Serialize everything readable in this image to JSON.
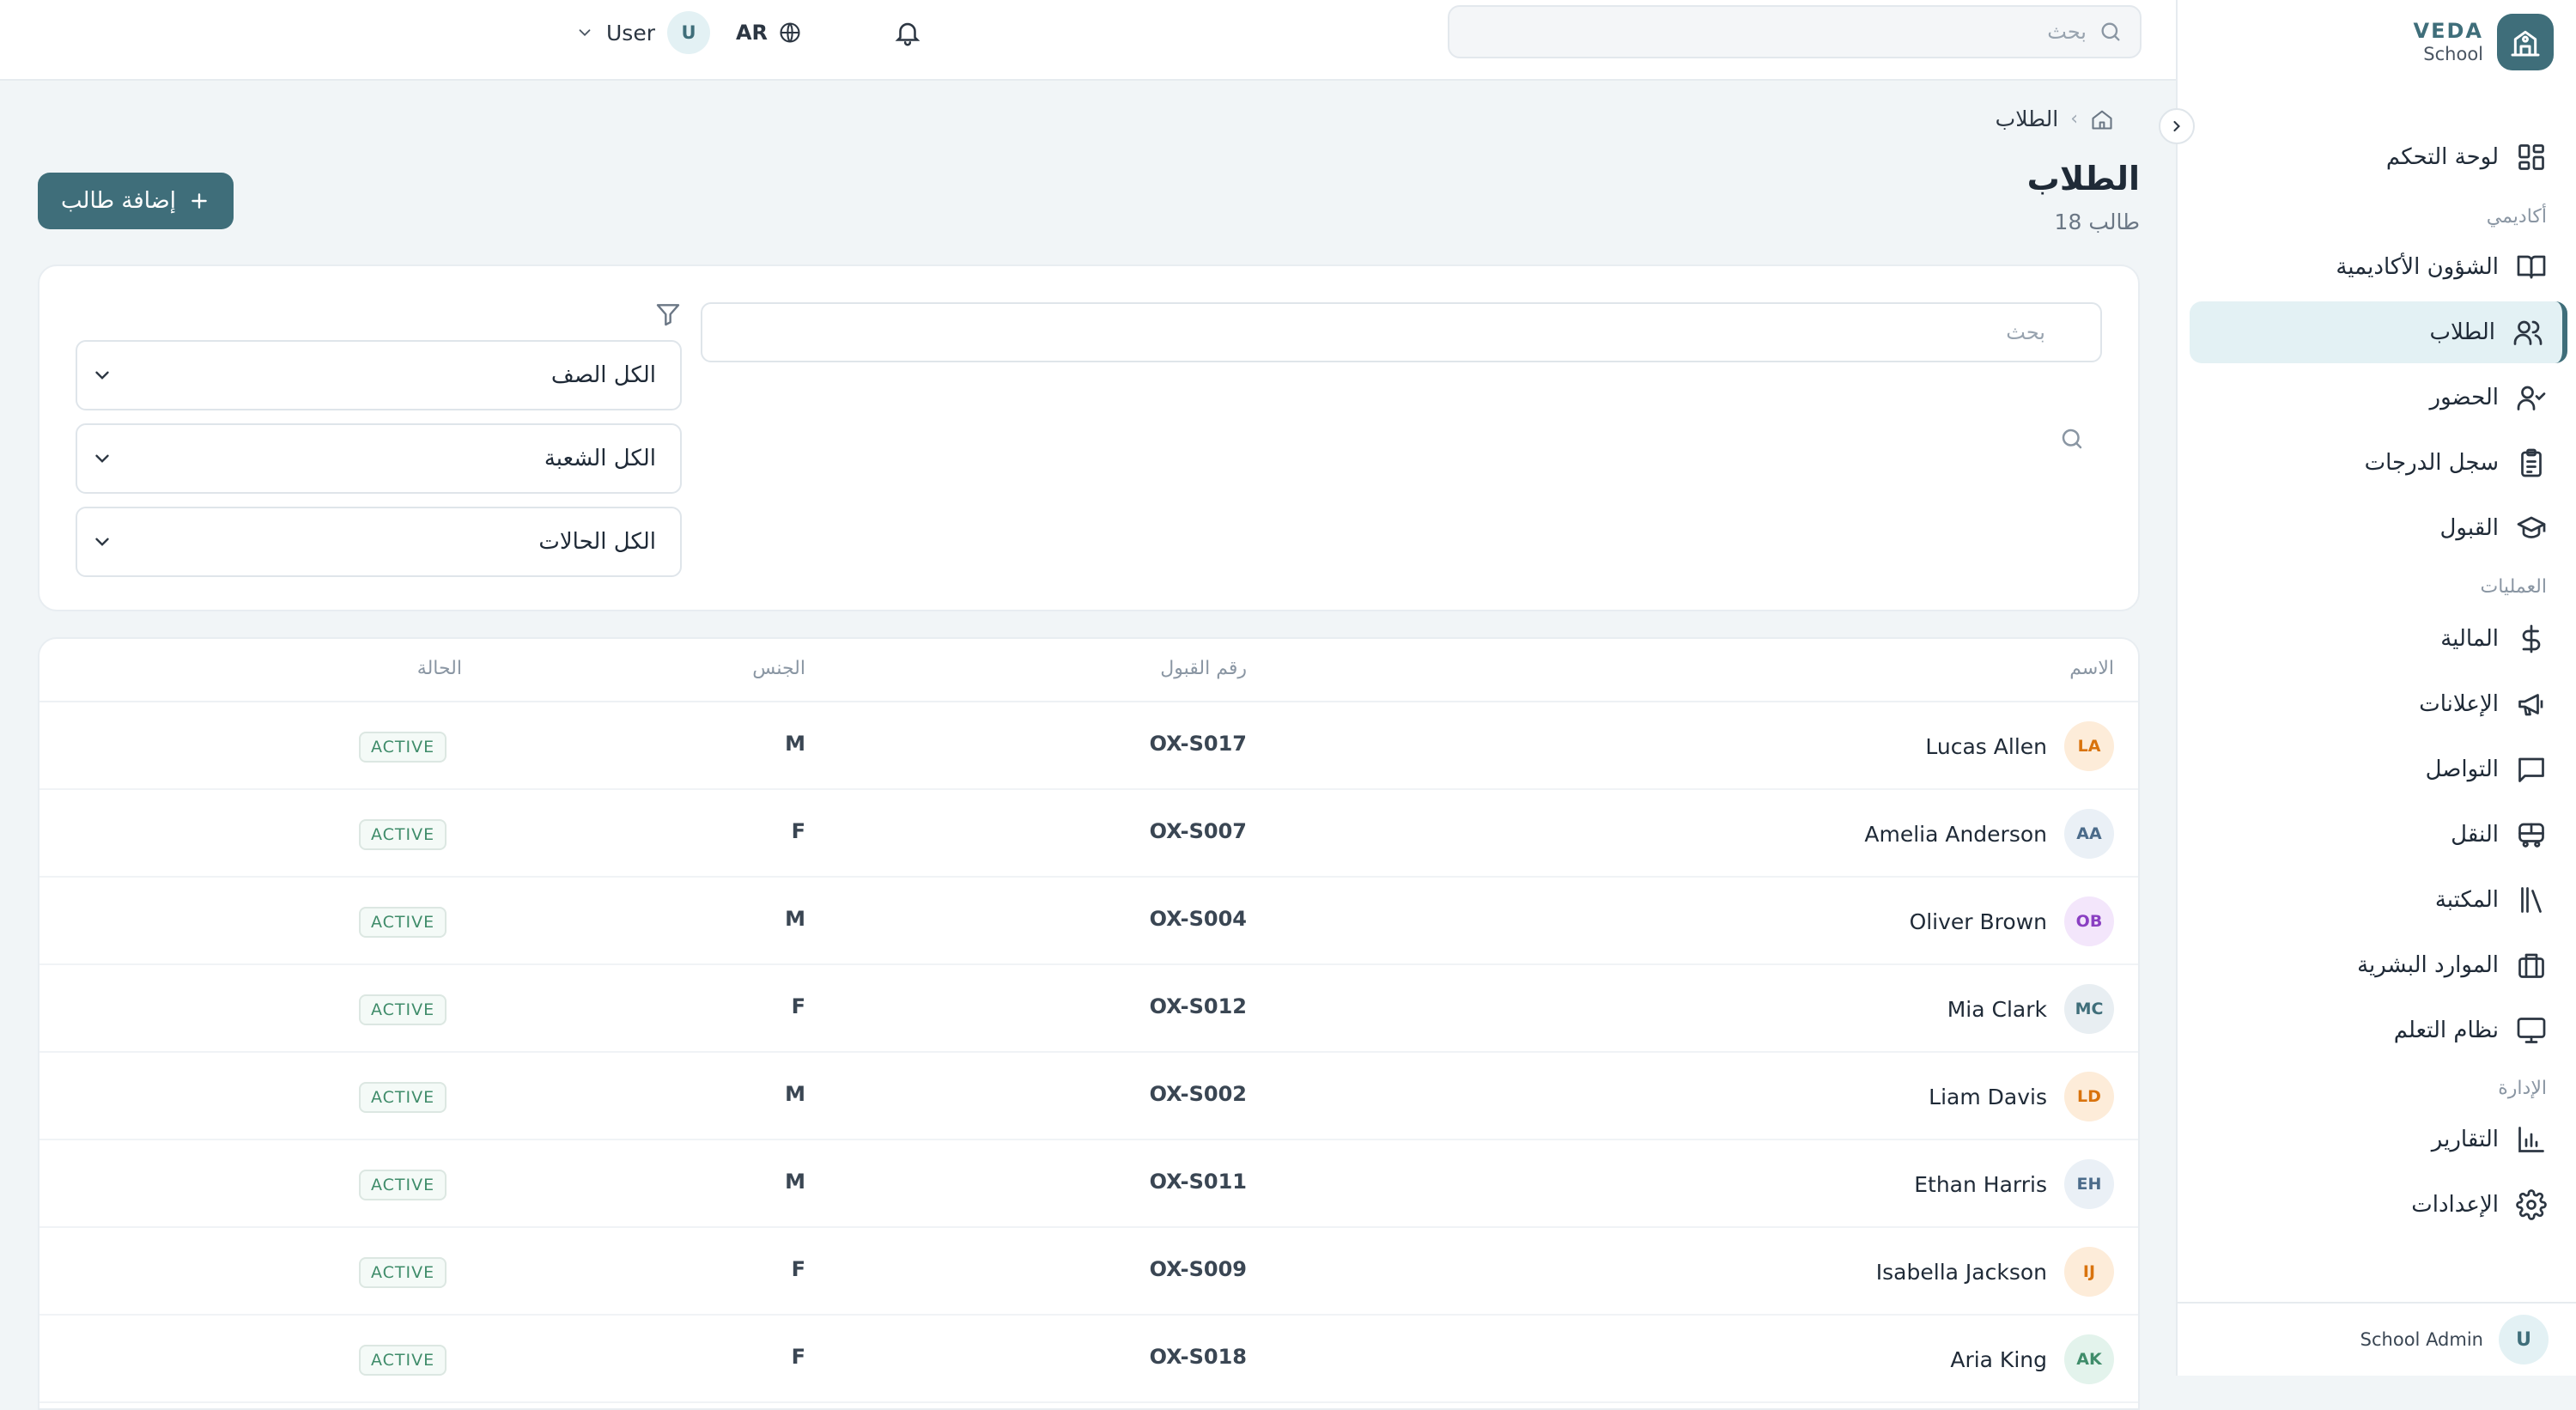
{
  "brand": {
    "name": "VEDA",
    "subtitle": "School"
  },
  "topbar": {
    "search_placeholder": "بحث",
    "language": "AR",
    "user_name": "User",
    "user_initial": "U"
  },
  "sidebar": {
    "sections": {
      "academic": "أكاديمي",
      "operations": "العمليات",
      "admin": "الإدارة"
    },
    "items": [
      {
        "label": "لوحة التحكم",
        "icon": "dashboard-icon"
      },
      {
        "label": "الشؤون الأكاديمية",
        "icon": "book-icon"
      },
      {
        "label": "الطلاب",
        "icon": "users-icon"
      },
      {
        "label": "الحضور",
        "icon": "user-check-icon"
      },
      {
        "label": "سجل الدرجات",
        "icon": "clipboard-icon"
      },
      {
        "label": "القبول",
        "icon": "graduation-cap-icon"
      },
      {
        "label": "المالية",
        "icon": "dollar-icon"
      },
      {
        "label": "الإعلانات",
        "icon": "megaphone-icon"
      },
      {
        "label": "التواصل",
        "icon": "message-icon"
      },
      {
        "label": "النقل",
        "icon": "bus-icon"
      },
      {
        "label": "المكتبة",
        "icon": "library-icon"
      },
      {
        "label": "الموارد البشرية",
        "icon": "briefcase-icon"
      },
      {
        "label": "نظام التعلم",
        "icon": "monitor-icon"
      },
      {
        "label": "التقارير",
        "icon": "chart-icon"
      },
      {
        "label": "الإعدادات",
        "icon": "gear-icon"
      }
    ],
    "footer": {
      "name": "School Admin",
      "initial": "U"
    }
  },
  "breadcrumb": {
    "current": "الطلاب"
  },
  "page": {
    "title": "الطلاب",
    "count": "18 طالب",
    "add_button": "إضافة طالب"
  },
  "filters": {
    "search_placeholder": "بحث",
    "class_select": "الكل الصف",
    "section_select": "الكل الشعبة",
    "status_select": "الكل الحالات"
  },
  "table": {
    "headers": {
      "name": "الاسم",
      "admission": "رقم القبول",
      "gender": "الجنس",
      "status": "الحالة"
    },
    "rows": [
      {
        "initials": "LA",
        "name": "Lucas Allen",
        "admission": "OX-S017",
        "gender": "M",
        "status": "ACTIVE",
        "avatar_bg": "#fdecd9",
        "avatar_fg": "#d9730d"
      },
      {
        "initials": "AA",
        "name": "Amelia Anderson",
        "admission": "OX-S007",
        "gender": "F",
        "status": "ACTIVE",
        "avatar_bg": "#eaf0f6",
        "avatar_fg": "#4b6b8a"
      },
      {
        "initials": "OB",
        "name": "Oliver Brown",
        "admission": "OX-S004",
        "gender": "M",
        "status": "ACTIVE",
        "avatar_bg": "#f3e6fb",
        "avatar_fg": "#8a3fc2"
      },
      {
        "initials": "MC",
        "name": "Mia Clark",
        "admission": "OX-S012",
        "gender": "F",
        "status": "ACTIVE",
        "avatar_bg": "#e8eef2",
        "avatar_fg": "#3f6e7a"
      },
      {
        "initials": "LD",
        "name": "Liam Davis",
        "admission": "OX-S002",
        "gender": "M",
        "status": "ACTIVE",
        "avatar_bg": "#fdecd9",
        "avatar_fg": "#d9730d"
      },
      {
        "initials": "EH",
        "name": "Ethan Harris",
        "admission": "OX-S011",
        "gender": "M",
        "status": "ACTIVE",
        "avatar_bg": "#eaf0f6",
        "avatar_fg": "#4b6b8a"
      },
      {
        "initials": "IJ",
        "name": "Isabella Jackson",
        "admission": "OX-S009",
        "gender": "F",
        "status": "ACTIVE",
        "avatar_bg": "#fdecd9",
        "avatar_fg": "#d9730d"
      },
      {
        "initials": "AK",
        "name": "Aria King",
        "admission": "OX-S018",
        "gender": "F",
        "status": "ACTIVE",
        "avatar_bg": "#e3f3ec",
        "avatar_fg": "#3f8c6a"
      }
    ]
  },
  "colors": {
    "accent": "#3f6e7a",
    "active_nav_bg": "#e3f1f4",
    "status_active": "#3f8c6a"
  }
}
